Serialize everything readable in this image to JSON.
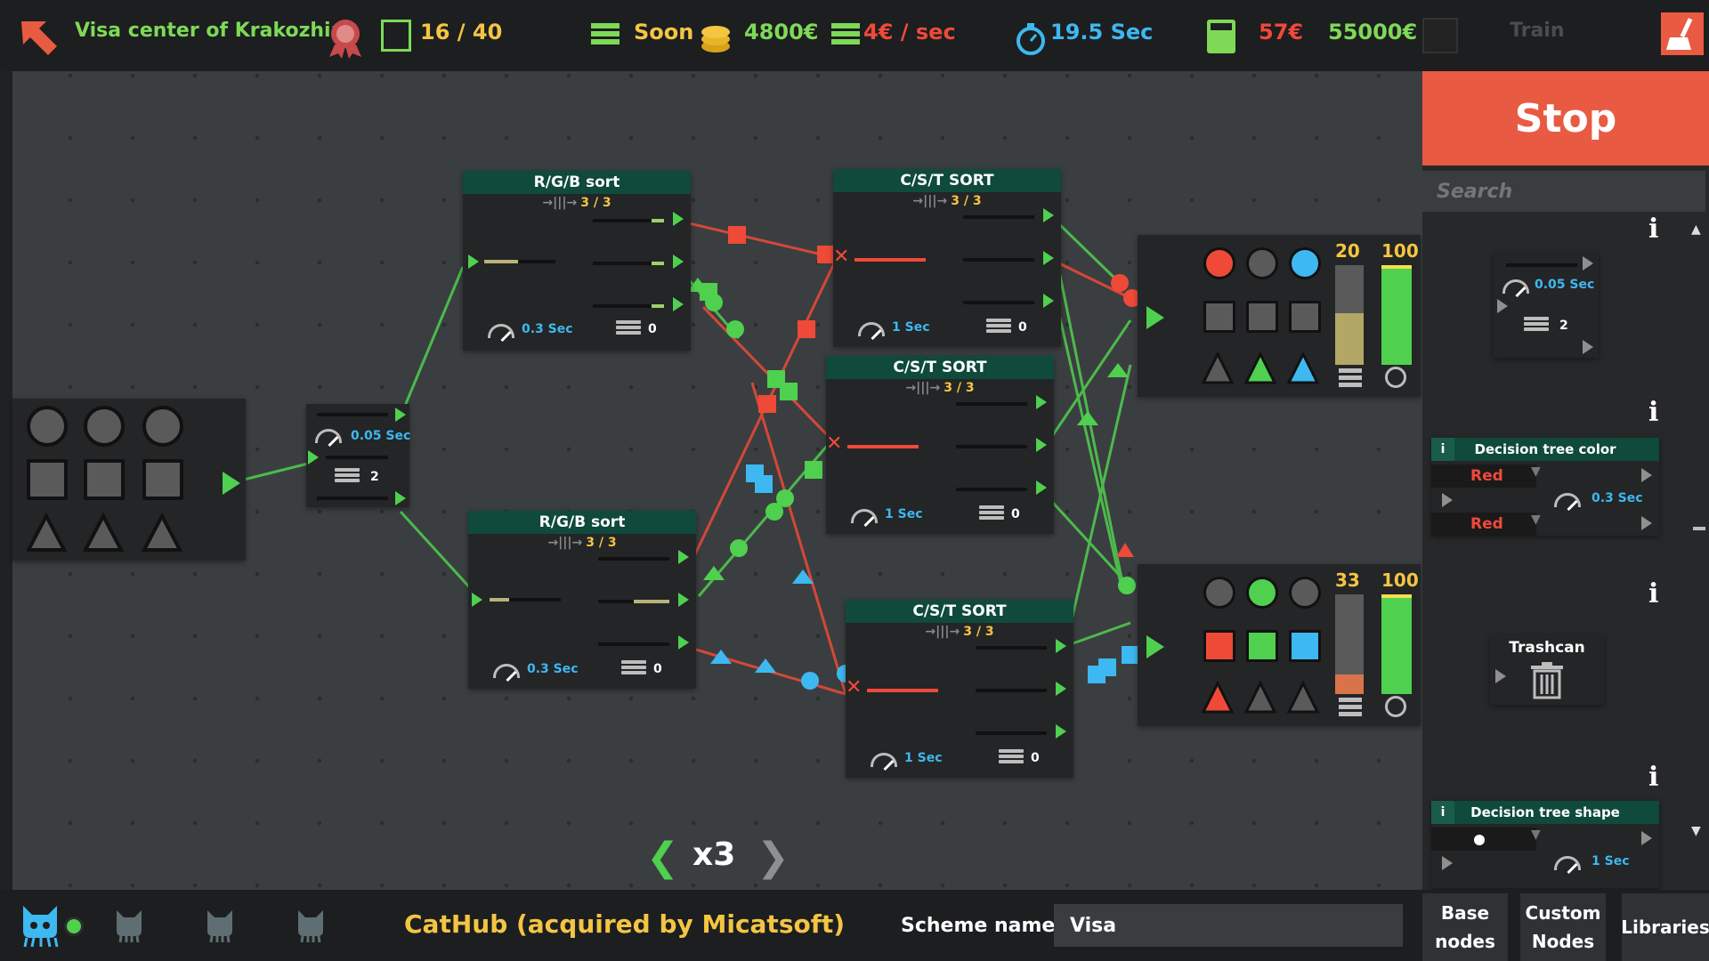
{
  "topbar": {
    "title": "Visa center of Krakozhia",
    "progress": "16 / 40",
    "status": "Soon",
    "money": "4800€",
    "income": "4€ / sec",
    "timer": "19.5 Sec",
    "cost": "57€",
    "target": "55000€",
    "train_label": "Train"
  },
  "right_panel": {
    "stop_label": "Stop",
    "search_placeholder": "Search",
    "items": [
      {
        "speed": "0.05 Sec",
        "count": "2"
      },
      {
        "title": "Decision tree color",
        "opt1": "Red",
        "opt2": "Red",
        "speed": "0.3 Sec"
      },
      {
        "title": "Trashcan"
      },
      {
        "title": "Decision tree shape",
        "speed": "1 Sec"
      }
    ],
    "tabs": [
      "Base nodes",
      "Custom Nodes",
      "Libraries"
    ]
  },
  "nodes": {
    "rgb_sort_1": {
      "title": "R/G/B sort",
      "count": "3 / 3",
      "speed": "0.3 Sec",
      "queue": "0"
    },
    "rgb_sort_2": {
      "title": "R/G/B sort",
      "count": "3 / 3",
      "speed": "0.3 Sec",
      "queue": "0"
    },
    "cst_sort_1": {
      "title": "C/S/T SORT",
      "count": "3 / 3",
      "speed": "1 Sec",
      "queue": "0"
    },
    "cst_sort_2": {
      "title": "C/S/T SORT",
      "count": "3 / 3",
      "speed": "1 Sec",
      "queue": "0"
    },
    "cst_sort_3": {
      "title": "C/S/T SORT",
      "count": "3 / 3",
      "speed": "1 Sec",
      "queue": "0"
    },
    "splitter": {
      "speed": "0.05 Sec",
      "count": "2"
    },
    "output_1": {
      "count": "20",
      "max": "100"
    },
    "output_2": {
      "count": "33",
      "max": "100"
    }
  },
  "speed_control": {
    "multiplier": "x3"
  },
  "bottombar": {
    "company": "CatHub (acquired by Micatsoft)",
    "scheme_label": "Scheme name :",
    "scheme_value": "Visa"
  },
  "colors": {
    "red": "#ef4a38",
    "green": "#4fd04f",
    "blue": "#3eb8f0",
    "grey": "#5a5a5a",
    "accent": "#e95a42"
  }
}
